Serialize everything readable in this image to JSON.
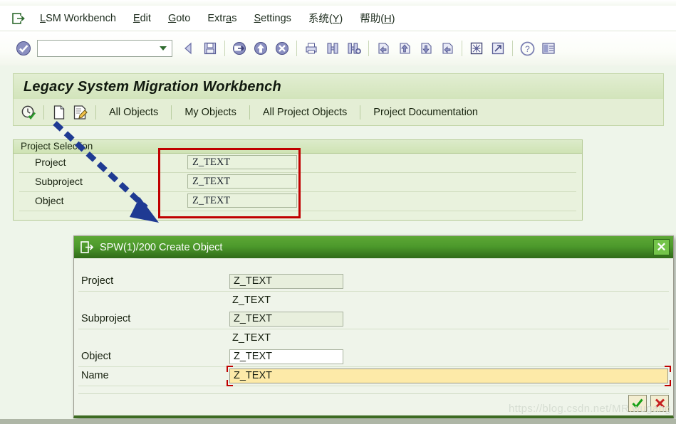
{
  "menu": {
    "system_icon": "exit-door-icon",
    "items": [
      {
        "label": "LSM Workbench",
        "accel": "L"
      },
      {
        "label": "Edit",
        "accel": "E"
      },
      {
        "label": "Goto",
        "accel": "G"
      },
      {
        "label": "Extras",
        "accel": "a"
      },
      {
        "label": "Settings",
        "accel": "S"
      },
      {
        "label": "系统(Y)",
        "accel": "Y"
      },
      {
        "label": "帮助(H)",
        "accel": "H"
      }
    ]
  },
  "toolbar": {
    "command_value": "",
    "command_placeholder": "",
    "icons": [
      "enter-check-icon",
      "back-arrow-icon",
      "save-icon",
      "exit-icon",
      "up-icon",
      "cancel-icon",
      "print-icon",
      "find-icon",
      "find-next-icon",
      "first-page-icon",
      "previous-page-icon",
      "next-page-icon",
      "last-page-icon",
      "create-session-icon",
      "shortcut-icon",
      "help-icon",
      "layout-menu-icon"
    ]
  },
  "app": {
    "title": "Legacy System Migration Workbench",
    "toolbar_icons": [
      "history-clock-icon",
      "new-document-icon",
      "edit-document-icon"
    ],
    "buttons": [
      "All Objects",
      "My Objects",
      "All Project Objects",
      "Project Documentation"
    ]
  },
  "project_selection": {
    "header": "Project Selection",
    "rows": [
      {
        "label": "Project",
        "value": "Z_TEXT"
      },
      {
        "label": "Subproject",
        "value": "Z_TEXT"
      },
      {
        "label": "Object",
        "value": "Z_TEXT"
      }
    ]
  },
  "annotations": {
    "box_color": "#c00000",
    "arrow_color": "#1f3a93"
  },
  "dialog": {
    "title": "SPW(1)/200 Create Object",
    "title_icon": "exit-door-icon",
    "close_label": "✕",
    "rows": [
      {
        "label": "Project",
        "value": "Z_TEXT",
        "state": "readonly"
      },
      {
        "label": "",
        "value": "Z_TEXT",
        "state": "text"
      },
      {
        "label": "Subproject",
        "value": "Z_TEXT",
        "state": "readonly"
      },
      {
        "label": "",
        "value": "Z_TEXT",
        "state": "text"
      },
      {
        "label": "Object",
        "value": "Z_TEXT",
        "state": "editable"
      },
      {
        "label": "Name",
        "value": "Z_TEXT",
        "state": "focused"
      }
    ],
    "confirm_label": "✔",
    "cancel_label": "✘",
    "confirm_color": "#16a016",
    "cancel_color": "#c62121"
  },
  "watermark": "https://blog.csdn.net/MR.wugang"
}
